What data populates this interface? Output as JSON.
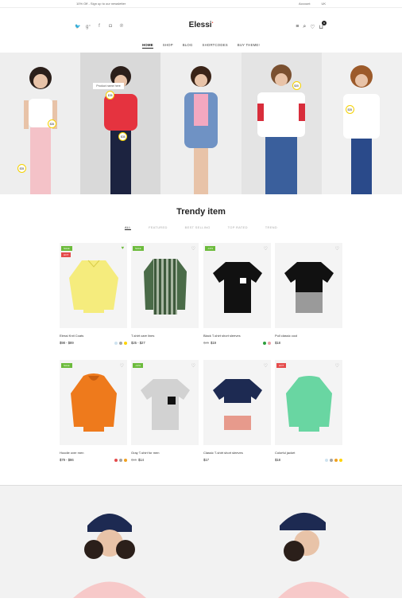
{
  "topbar": {
    "promo": "10% Off - Sign up to our newsletter",
    "account": "Account",
    "language": "UK"
  },
  "header": {
    "logo": "Elessi",
    "cart_count": "0"
  },
  "nav": [
    "HOME",
    "SHOP",
    "BLOG",
    "SHORTCODES",
    "BUY THEME!"
  ],
  "hero": {
    "tooltip": "Product name here",
    "price_tag": "$35"
  },
  "section": {
    "title": "Trendy item"
  },
  "tabs": [
    "ALL",
    "FEATURED",
    "BEST SELLING",
    "TOP RATED",
    "TREND"
  ],
  "products": [
    {
      "name": "Elessi Knit Coats",
      "price": "$98 - $89",
      "old": "",
      "badges": [
        "SALE",
        "HOT"
      ],
      "liked": true,
      "swatches": [
        "#cfe3f0",
        "#a4a4a4",
        "#ffd400"
      ]
    },
    {
      "name": "T-shirt care lines",
      "price": "$25 - $27",
      "old": "",
      "badges": [
        "SALE"
      ],
      "liked": false,
      "swatches": []
    },
    {
      "name": "Black T-shirt short sleeves",
      "price": "$19",
      "old": "$25",
      "badges": [
        "-13%"
      ],
      "liked": false,
      "swatches": [
        "#2e9e3d",
        "#e8a0a8"
      ]
    },
    {
      "name": "Pull classic cool",
      "price": "$18",
      "old": "",
      "badges": [],
      "liked": false,
      "swatches": []
    },
    {
      "name": "Hoodie over men",
      "price": "$79 - $86",
      "old": "",
      "badges": [
        "SALE"
      ],
      "liked": false,
      "swatches": [
        "#e54b4b",
        "#a4a4a4",
        "#f0a020"
      ]
    },
    {
      "name": "Gray T-shirt for men",
      "price": "$14",
      "old": "$15",
      "badges": [
        "-13%"
      ],
      "liked": false,
      "swatches": []
    },
    {
      "name": "Classic T-shirt short sleeves",
      "price": "$17",
      "old": "",
      "badges": [],
      "liked": false,
      "swatches": []
    },
    {
      "name": "Colorful jacket",
      "price": "$18",
      "old": "",
      "badges": [
        "HOT"
      ],
      "liked": false,
      "swatches": [
        "#cfe3f0",
        "#a4a4a4",
        "#f0a020",
        "#ffd400"
      ]
    }
  ]
}
